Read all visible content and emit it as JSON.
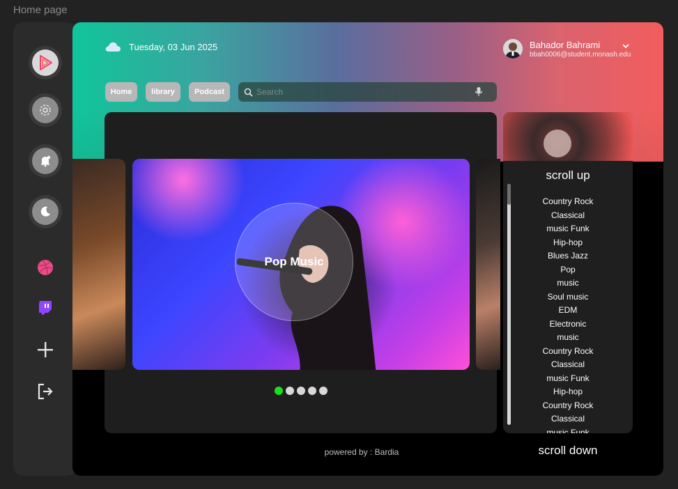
{
  "page_label": "Home page",
  "header": {
    "date": "Tuesday, 03 Jun 2025",
    "user_name": "Bahador Bahrami",
    "user_email": "bbah0006@student.monash.edu"
  },
  "nav": {
    "home_label": "Home",
    "library_label": "library",
    "podcast_label": "Podcast"
  },
  "search": {
    "placeholder": "Search"
  },
  "carousel": {
    "current_title": "Pop Music",
    "active_index": 0,
    "count": 5
  },
  "genres": {
    "scroll_up_label": "scroll up",
    "scroll_down_label": "scroll down",
    "items": [
      "Country Rock",
      "Classical",
      "music Funk",
      "Hip-hop",
      "Blues Jazz",
      "Pop",
      "music",
      "Soul music",
      "EDM",
      "Electronic",
      "music",
      "Country Rock",
      "Classical",
      "music Funk",
      "Hip-hop",
      "Country Rock",
      "Classical",
      "music Funk"
    ]
  },
  "footer": {
    "text": "powered by : Bardia"
  },
  "colors": {
    "accent_green": "#19e019",
    "gradient_start": "#10c59a",
    "gradient_end": "#f25d5d"
  },
  "icons": {
    "sidebar": [
      "play-logo-icon",
      "gear-icon",
      "bell-icon",
      "moon-icon",
      "dribbble-icon",
      "twitch-icon",
      "plus-icon",
      "logout-icon"
    ]
  }
}
